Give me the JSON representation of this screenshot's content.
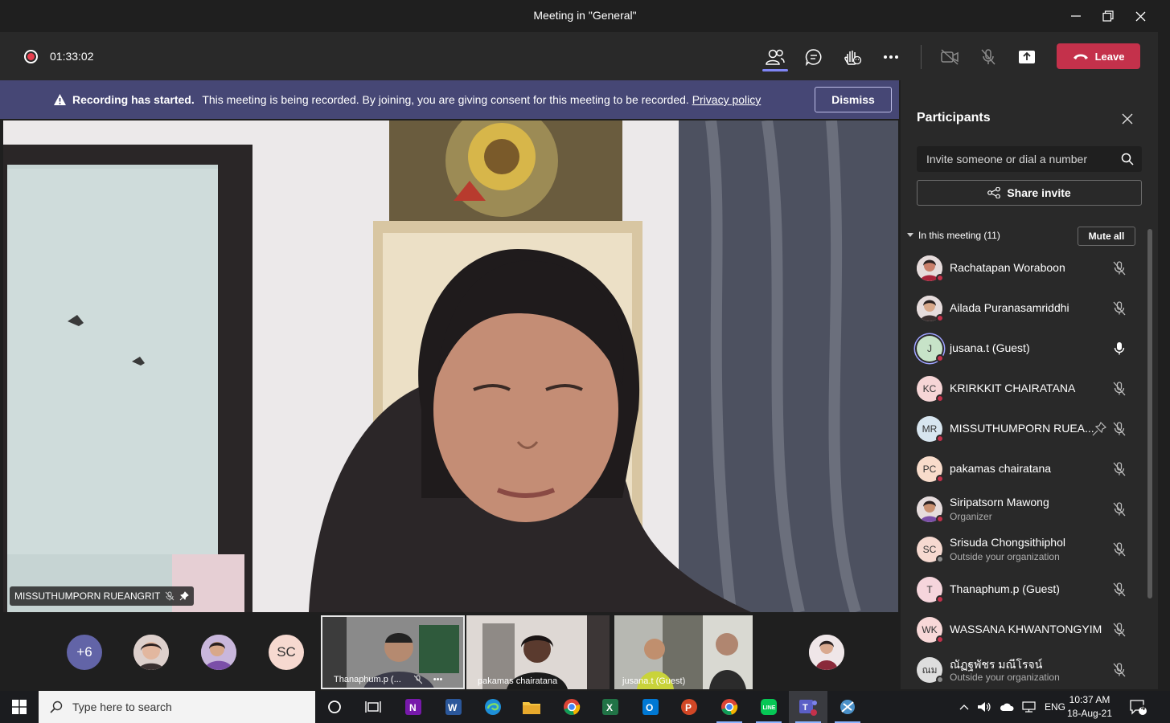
{
  "window": {
    "title": "Meeting in \"General\""
  },
  "toolbar": {
    "timer": "01:33:02",
    "leave_label": "Leave"
  },
  "banner": {
    "bold": "Recording has started.",
    "text": "This meeting is being recorded. By joining, you are giving consent for this meeting to be recorded.",
    "link": "Privacy policy",
    "dismiss": "Dismiss"
  },
  "main_video": {
    "name": "MISSUTHUMPORN RUEANGRIT"
  },
  "strip": {
    "overflow": "+6",
    "sc_initials": "SC",
    "thumbs": [
      {
        "label": "Thanaphum.p (..."
      },
      {
        "label": "pakamas chairatana"
      },
      {
        "label": "jusana.t (Guest)"
      }
    ]
  },
  "panel": {
    "title": "Participants",
    "invite_placeholder": "Invite someone or dial a number",
    "share_invite": "Share invite",
    "section": "In this meeting (11)",
    "mute_all": "Mute all",
    "participants": [
      {
        "name": "Rachatapan Woraboon",
        "sub": "",
        "initials": "",
        "color": "#f2dce0"
      },
      {
        "name": "Ailada Puranasamriddhi",
        "sub": "",
        "initials": "",
        "color": "#e9d8d4"
      },
      {
        "name": "jusana.t (Guest)",
        "sub": "",
        "initials": "J",
        "color": "#c7e3c8"
      },
      {
        "name": "KRIRKKIT CHAIRATANA",
        "sub": "",
        "initials": "KC",
        "color": "#f6d5d6"
      },
      {
        "name": "MISSUTHUMPORN RUEA...",
        "sub": "",
        "initials": "MR",
        "color": "#d7e5ef"
      },
      {
        "name": "pakamas chairatana",
        "sub": "",
        "initials": "PC",
        "color": "#f8dccb"
      },
      {
        "name": "Siripatsorn Mawong",
        "sub": "Organizer",
        "initials": "",
        "color": "#d8d0e8"
      },
      {
        "name": "Srisuda Chongsithiphol",
        "sub": "Outside your organization",
        "initials": "SC",
        "color": "#f6d9d0"
      },
      {
        "name": "Thanaphum.p (Guest)",
        "sub": "",
        "initials": "T",
        "color": "#f6d5dc"
      },
      {
        "name": "WASSANA KHWANTONGYIM",
        "sub": "",
        "initials": "WK",
        "color": "#f8d8d8"
      },
      {
        "name": "ณัฏฐพัชร มณีโรจน์",
        "sub": "Outside your organization",
        "initials": "ณม",
        "color": "#dedede"
      }
    ]
  },
  "taskbar": {
    "search_placeholder": "Type here to search",
    "lang": "ENG",
    "time": "10:37 AM",
    "date": "18-Aug-21",
    "notif_count": "4"
  }
}
